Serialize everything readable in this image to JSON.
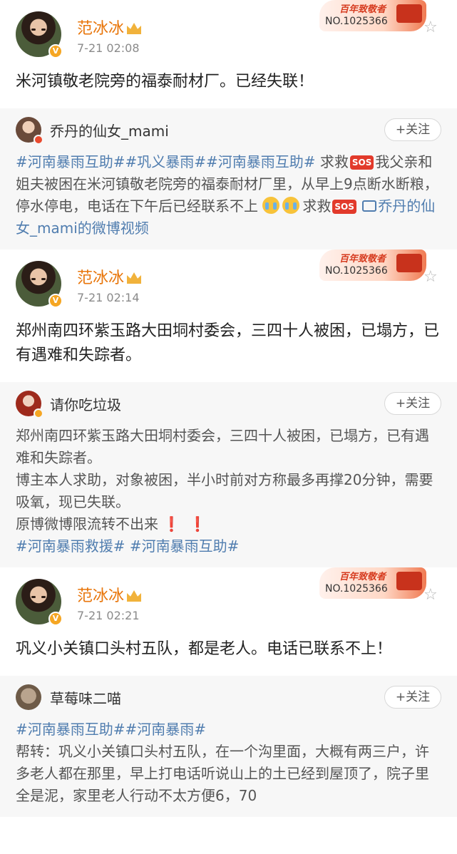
{
  "posts": [
    {
      "author": "范冰冰",
      "time": "7-21 02:08",
      "award_title": "百年致敬者",
      "award_no": "NO.1025366",
      "text": "米河镇敬老院旁的福泰耐材厂。已经失联！",
      "repost": {
        "name": "乔丹的仙女_mami",
        "follow": "+关注",
        "topics": [
          "#河南暴雨互助#",
          "#巩义暴雨#",
          "#河南暴雨互助#"
        ],
        "seg1": " 求救",
        "seg2": "我父亲和姐夫被困在米河镇敬老院旁的福泰耐材厂里，从早上9点断水断粮，停水停电，电话在下午后已经联系不上",
        "seg3": "求救",
        "sos": "SOS",
        "video_link": "乔丹的仙女_mami的微博视频"
      }
    },
    {
      "author": "范冰冰",
      "time": "7-21 02:14",
      "award_title": "百年致敬者",
      "award_no": "NO.1025366",
      "text": "郑州南四环紫玉路大田垌村委会，三四十人被困，已塌方，已有遇难和失踪者。",
      "repost": {
        "name": "请你吃垃圾",
        "follow": "+关注",
        "line1": "郑州南四环紫玉路大田垌村委会，三四十人被困，已塌方，已有遇难和失踪者。",
        "line2": "博主本人求助，对象被困，半小时前对方称最多再撑20分钟，需要吸氧，现已失联。",
        "line3": "原博微博限流转不出来",
        "excl": "❗",
        "topic1": "#河南暴雨救援#",
        "topic2": "#河南暴雨互助#"
      }
    },
    {
      "author": "范冰冰",
      "time": "7-21 02:21",
      "award_title": "百年致敬者",
      "award_no": "NO.1025366",
      "text": "巩义小关镇口头村五队，都是老人。电话已联系不上！",
      "repost": {
        "name": "草莓味二喵",
        "follow": "+关注",
        "topics": [
          "#河南暴雨互助#",
          "#河南暴雨#"
        ],
        "body": "帮转：巩义小关镇口头村五队，在一个沟里面，大概有两三户，许多老人都在那里，早上打电话听说山上的土已经到屋顶了，院子里全是泥，家里老人行动不太方便6，70"
      }
    }
  ]
}
